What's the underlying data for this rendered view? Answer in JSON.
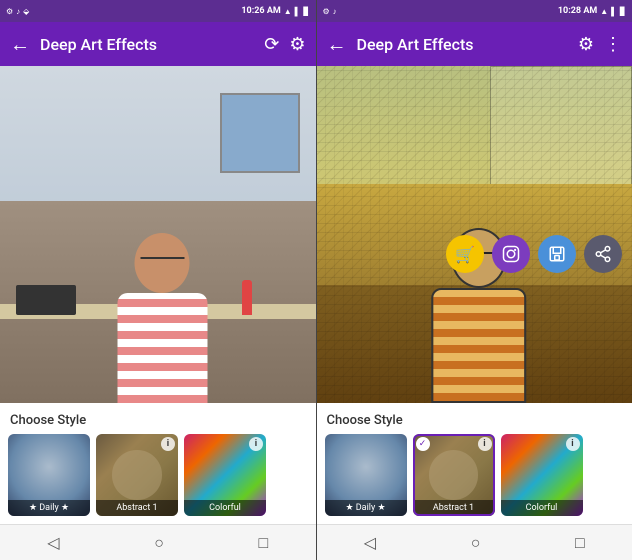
{
  "left_screen": {
    "status_bar": {
      "time": "10:26 AM",
      "icons": [
        "bluetooth",
        "music",
        "battery",
        "signal"
      ]
    },
    "toolbar": {
      "title": "Deep Art Effects",
      "back_label": "←",
      "rotate_icon": "rotate",
      "settings_icon": "settings"
    },
    "choose_style_label": "Choose Style",
    "styles": [
      {
        "id": "daily",
        "label": "★ Daily ★",
        "has_info": false,
        "selected": false
      },
      {
        "id": "abstract1",
        "label": "Abstract 1",
        "has_info": true,
        "selected": false
      },
      {
        "id": "colorful",
        "label": "Colorful",
        "has_info": true,
        "selected": false
      }
    ],
    "nav": {
      "back": "◁",
      "home": "○",
      "recents": "□"
    }
  },
  "right_screen": {
    "status_bar": {
      "time": "10:28 AM",
      "icons": [
        "bluetooth",
        "music",
        "battery",
        "signal"
      ]
    },
    "toolbar": {
      "title": "Deep Art Effects",
      "back_label": "←",
      "settings_icon": "settings",
      "more_icon": "more"
    },
    "action_buttons": [
      {
        "id": "cart",
        "icon": "🛒",
        "color": "yellow"
      },
      {
        "id": "instagram",
        "icon": "📷",
        "color": "purple"
      },
      {
        "id": "save",
        "icon": "💾",
        "color": "blue"
      },
      {
        "id": "share",
        "icon": "↗",
        "color": "dark"
      }
    ],
    "choose_style_label": "Choose Style",
    "styles": [
      {
        "id": "daily",
        "label": "★ Daily ★",
        "has_info": false,
        "selected": false
      },
      {
        "id": "abstract1",
        "label": "Abstract 1",
        "has_info": true,
        "selected": true
      },
      {
        "id": "colorful",
        "label": "Colorful",
        "has_info": true,
        "selected": false
      }
    ],
    "nav": {
      "back": "◁",
      "home": "○",
      "recents": "□"
    }
  },
  "colors": {
    "toolbar_bg": "#6a1fb5",
    "status_bar_bg": "#5c2d91",
    "accent": "#6a1fb5",
    "yellow": "#f5c400",
    "nav_bg": "#f5f5f5"
  }
}
